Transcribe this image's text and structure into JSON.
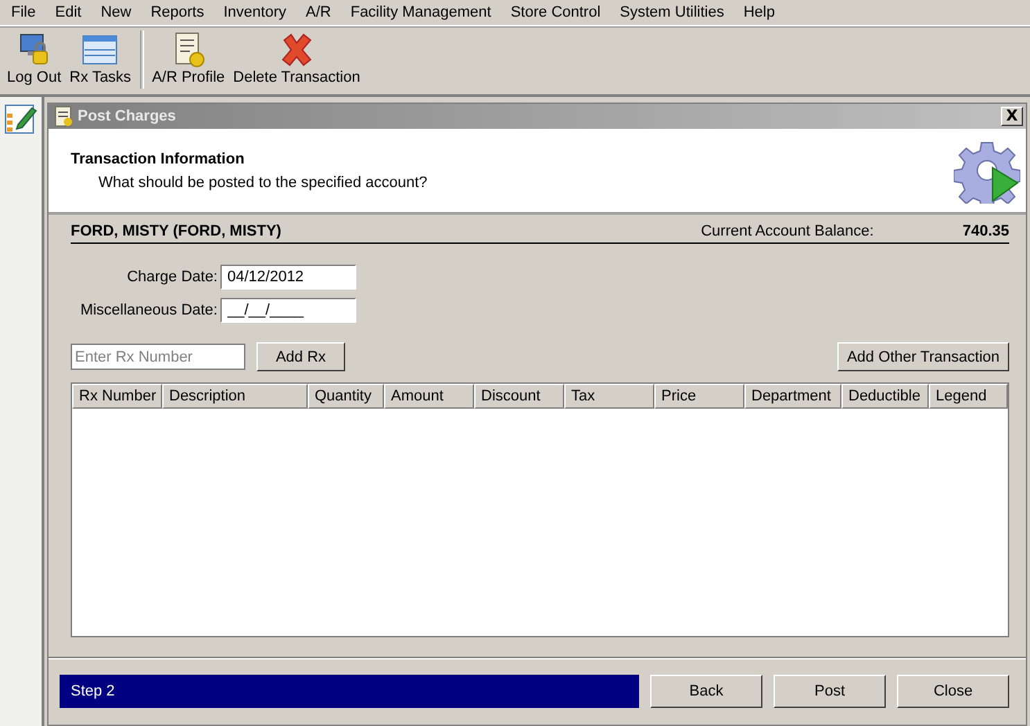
{
  "menu": [
    "File",
    "Edit",
    "New",
    "Reports",
    "Inventory",
    "A/R",
    "Facility Management",
    "Store Control",
    "System Utilities",
    "Help"
  ],
  "toolbar": [
    {
      "kind": "logout",
      "label": "Log Out"
    },
    {
      "kind": "tasks",
      "label": "Rx Tasks"
    },
    {
      "kind": "separator"
    },
    {
      "kind": "profile",
      "label": "A/R Profile"
    },
    {
      "kind": "delete",
      "label": "Delete Transaction"
    }
  ],
  "window": {
    "title": "Post Charges",
    "close": "X"
  },
  "header": {
    "title": "Transaction Information",
    "subtitle": "What should be posted to the specified account?"
  },
  "account": {
    "name": "FORD, MISTY (FORD, MISTY)",
    "balance_label": "Current Account Balance:",
    "balance": "740.35"
  },
  "fields": [
    {
      "label": "Charge Date:",
      "value": "04/12/2012"
    },
    {
      "label": "Miscellaneous Date:",
      "value": "__/__/____"
    }
  ],
  "rx_entry": {
    "placeholder": "Enter Rx Number",
    "button": "Add Rx",
    "other_button": "Add Other Transaction"
  },
  "table": {
    "columns": [
      "Rx Number",
      "Description",
      "Quantity",
      "Amount",
      "Discount",
      "Tax",
      "Price",
      "Department",
      "Deductible",
      "Legend"
    ]
  },
  "footer": {
    "step": "Step 2",
    "buttons": [
      "Back",
      "Post",
      "Close"
    ]
  }
}
